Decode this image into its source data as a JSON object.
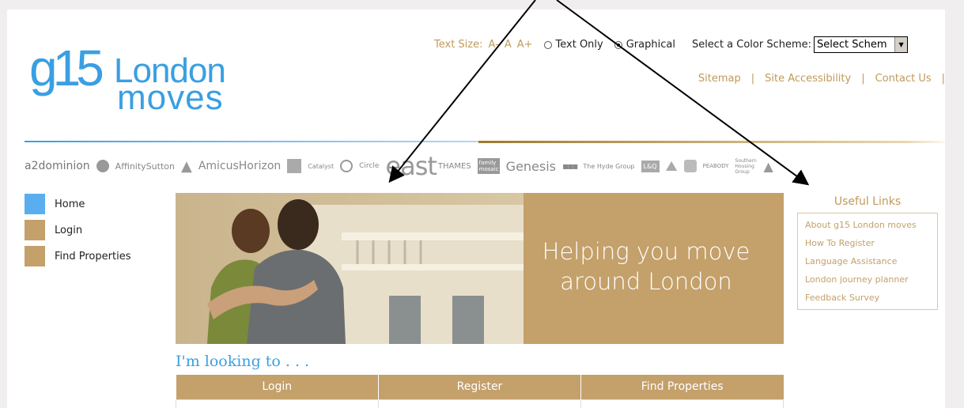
{
  "logo": {
    "line_g15": "g15",
    "line1": "London",
    "line2": "moves"
  },
  "options": {
    "text_size_label": "Text Size:",
    "size_small": "A-",
    "size_normal": "A",
    "size_large": "A+",
    "text_only_label": "Text Only",
    "graphical_label": "Graphical",
    "color_scheme_label": "Select a Color Scheme:",
    "color_scheme_value": "Select Schem"
  },
  "top_links": [
    "Sitemap",
    "Site Accessibility",
    "Contact Us"
  ],
  "partners": [
    "a2dominion",
    "AffinitySutton",
    "AmicusHorizon",
    "Catalyst",
    "Circle",
    "east",
    "THAMES",
    "family mosaic",
    "Genesis",
    "The Hyde Group",
    "L&Q",
    "PEABODY",
    "Southern Housing Group"
  ],
  "left_nav": [
    {
      "label": "Home",
      "color": "#5aaef0"
    },
    {
      "label": "Login",
      "color": "#c4a06a"
    },
    {
      "label": "Find Properties",
      "color": "#c4a06a"
    }
  ],
  "banner": {
    "line1": "Helping you move",
    "line2": "around London"
  },
  "looking": {
    "heading": "I'm looking to . . .",
    "columns": [
      "Login",
      "Register",
      "Find Properties"
    ]
  },
  "useful_links": {
    "title": "Useful Links",
    "items": [
      "About g15 London moves",
      "How To Register",
      "Language Assistance",
      "London journey planner",
      "Feedback Survey"
    ]
  },
  "colors": {
    "blue": "#3a9fe2",
    "gold": "#c4a06a",
    "page_bg": "#f1eef0"
  }
}
